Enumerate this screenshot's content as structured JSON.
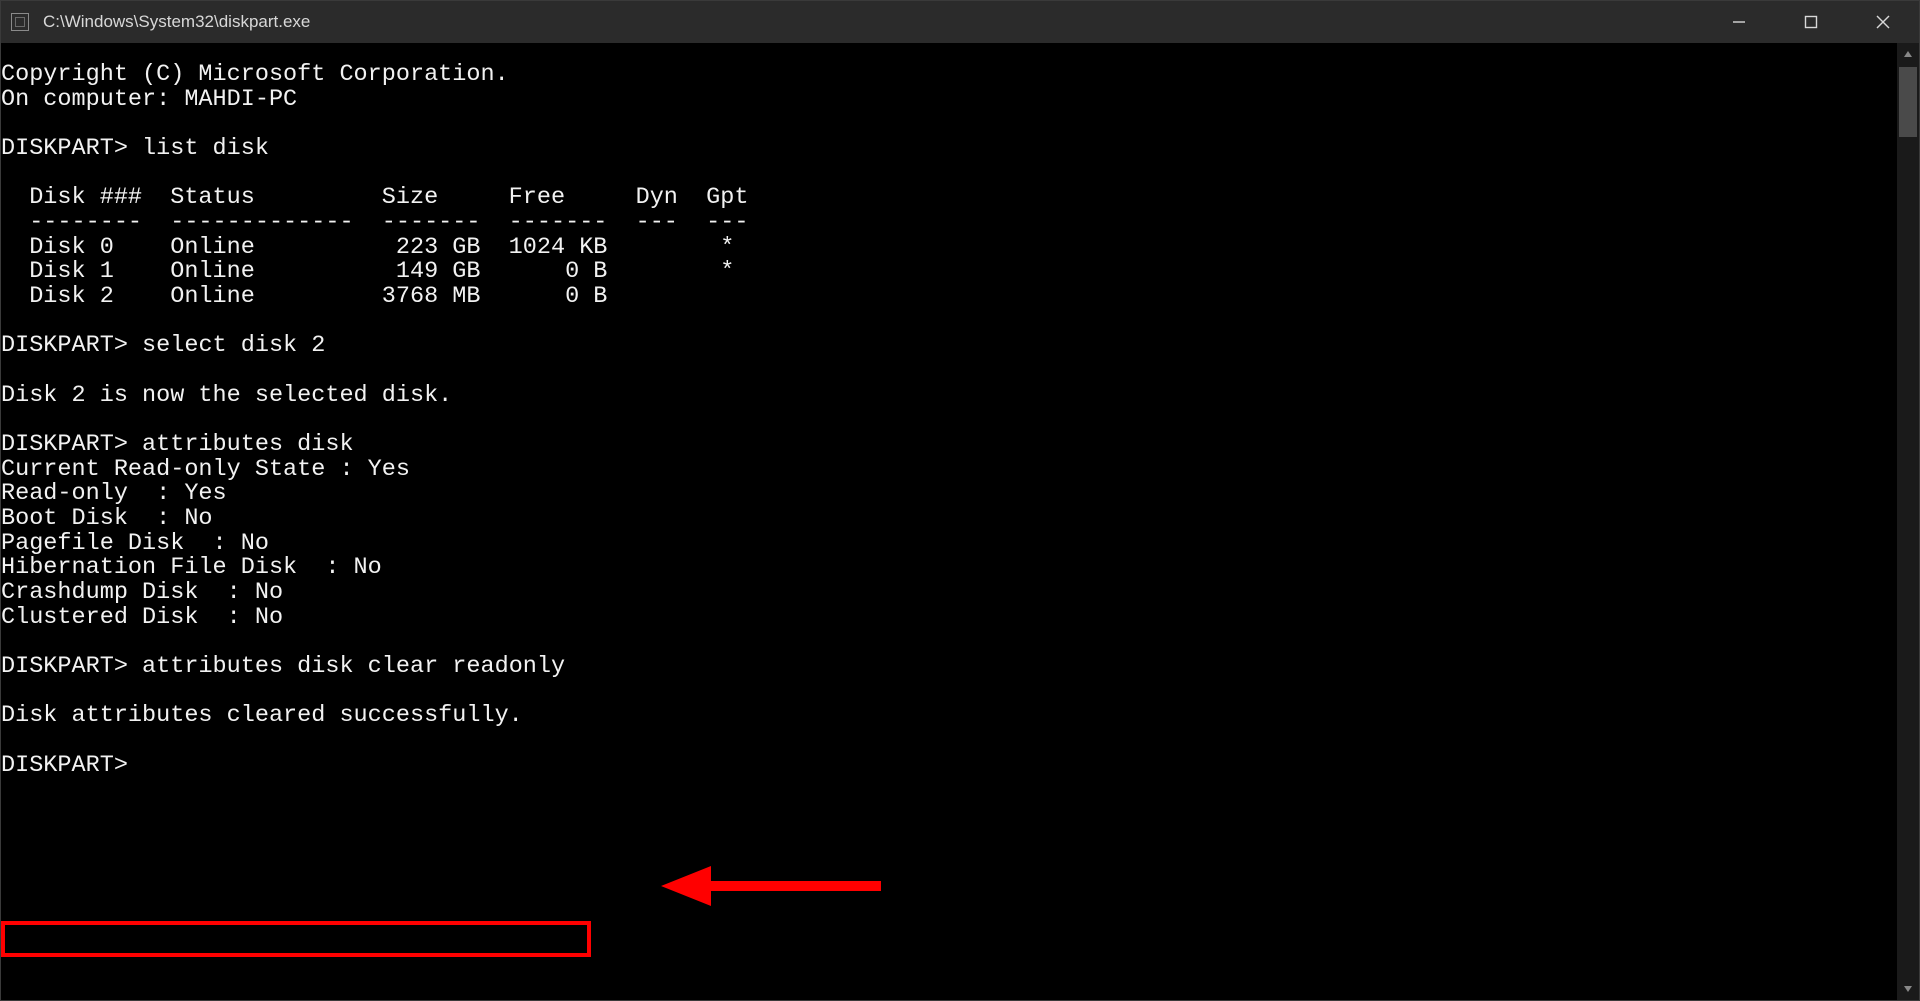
{
  "window": {
    "title": "C:\\Windows\\System32\\diskpart.exe"
  },
  "terminal": {
    "copyright": "Copyright (C) Microsoft Corporation.",
    "computer_line": "On computer: MAHDI-PC",
    "prompt": "DISKPART>",
    "cmd_list_disk": "list disk",
    "table_header": "  Disk ###  Status         Size     Free     Dyn  Gpt",
    "table_divider": "  --------  -------------  -------  -------  ---  ---",
    "disk0": "  Disk 0    Online          223 GB  1024 KB        *",
    "disk1": "  Disk 1    Online          149 GB      0 B        *",
    "disk2": "  Disk 2    Online         3768 MB      0 B",
    "cmd_select_disk": "select disk 2",
    "selected_msg": "Disk 2 is now the selected disk.",
    "cmd_attributes_disk": "attributes disk",
    "attr_current_ro": "Current Read-only State : Yes",
    "attr_ro": "Read-only  : Yes",
    "attr_boot": "Boot Disk  : No",
    "attr_pagefile": "Pagefile Disk  : No",
    "attr_hiber": "Hibernation File Disk  : No",
    "attr_crash": "Crashdump Disk  : No",
    "attr_clustered": "Clustered Disk  : No",
    "cmd_clear_ro": "attributes disk clear readonly",
    "cleared_msg": "Disk attributes cleared successfully."
  }
}
